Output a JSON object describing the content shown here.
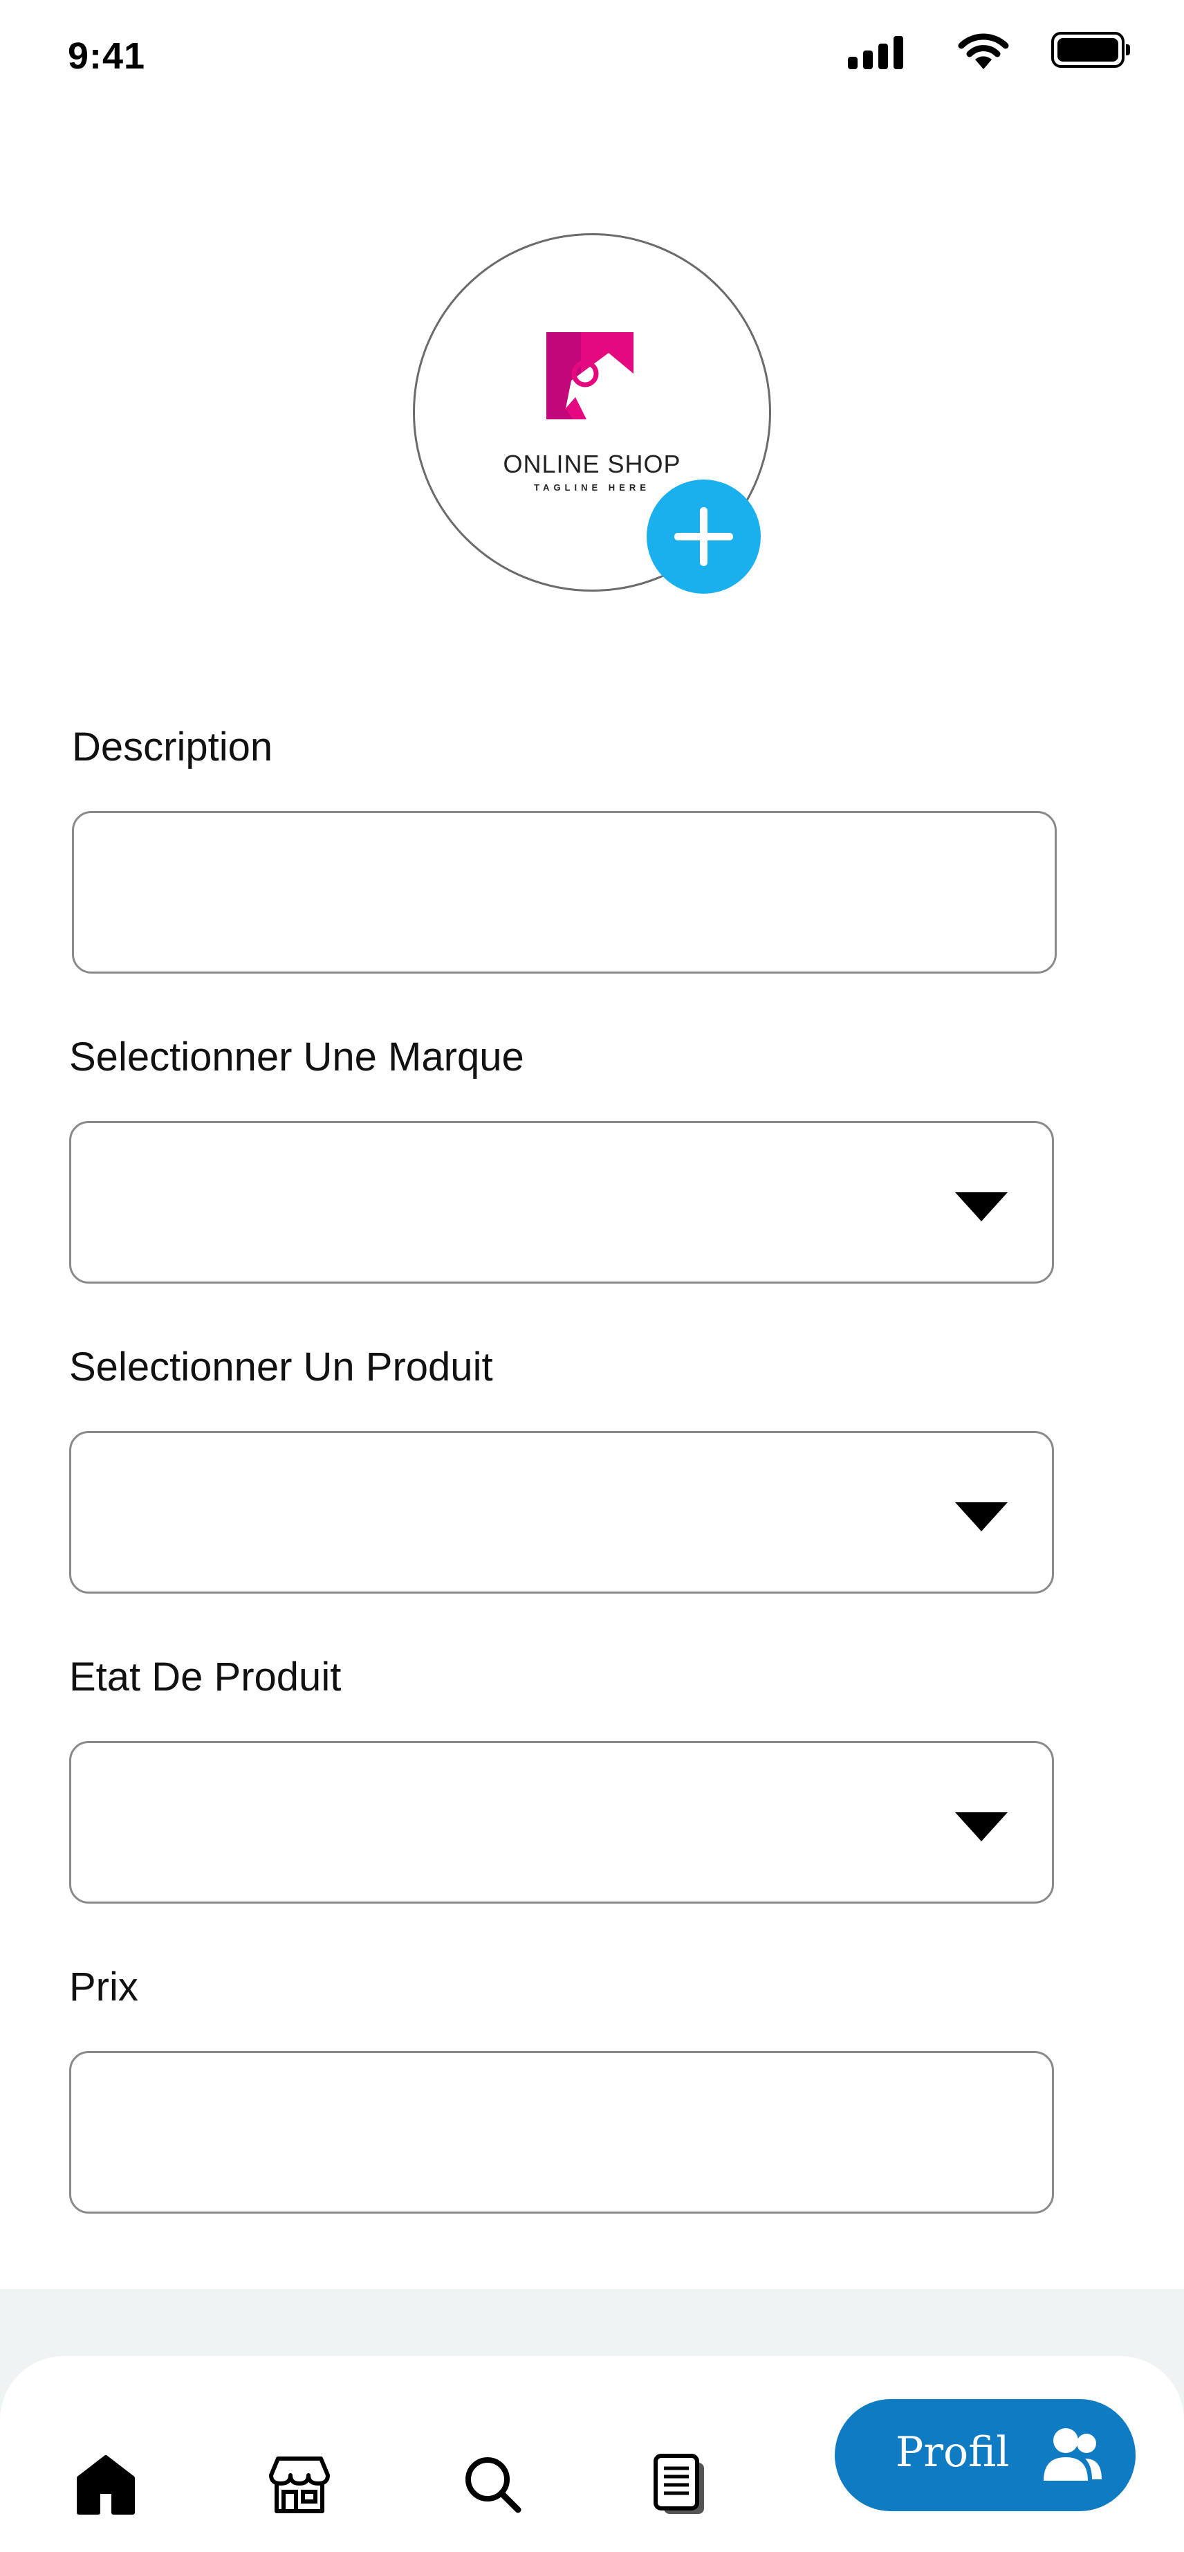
{
  "status_bar": {
    "time": "9:41",
    "icons": [
      "signal-icon",
      "wifi-icon",
      "battery-icon"
    ]
  },
  "logo": {
    "title": "ONLINE SHOP",
    "tagline": "TAGLINE HERE",
    "brand_color": "#e4097f",
    "add_button_color": "#1ab0ee",
    "add_icon": "plus-icon"
  },
  "form": {
    "description_label": "Description",
    "description_value": "",
    "brand_label": "Selectionner Une Marque",
    "brand_value": "",
    "product_label": "Selectionner Un Produit",
    "product_value": "",
    "condition_label": "Etat De Produit",
    "condition_value": "",
    "price_label": "Prix",
    "price_value": ""
  },
  "bottom_nav": {
    "items": [
      {
        "name": "home",
        "icon": "home-icon",
        "active": true
      },
      {
        "name": "shop",
        "icon": "store-icon"
      },
      {
        "name": "search",
        "icon": "search-icon"
      },
      {
        "name": "orders",
        "icon": "document-icon"
      }
    ],
    "profile_label": "Profil",
    "profile_icon": "users-icon",
    "profile_color": "#0f7bc2"
  }
}
